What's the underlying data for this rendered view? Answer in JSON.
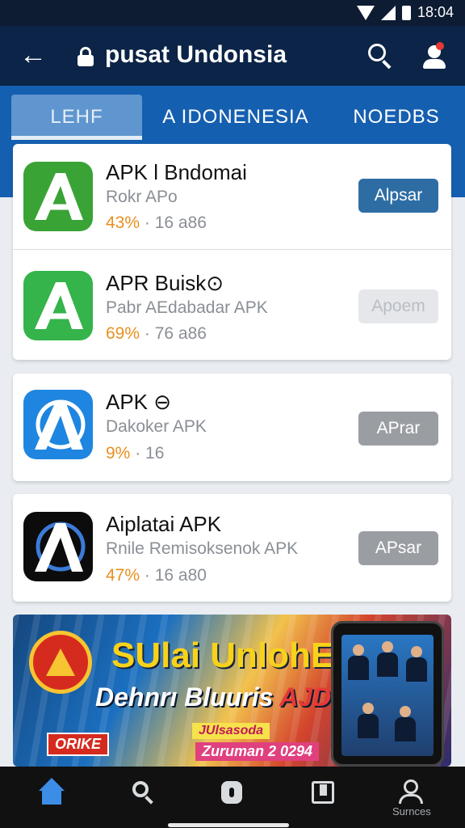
{
  "status_bar": {
    "time": "18:04"
  },
  "header": {
    "title": "pusat Undonsia"
  },
  "tabs": [
    {
      "label": "LEHF",
      "active": true
    },
    {
      "label": "A IDONENESIA",
      "active": false
    },
    {
      "label": "NOEDBS",
      "active": false
    }
  ],
  "apps": [
    {
      "name": "APK l Bndomai",
      "subtitle": "Rokr APo",
      "percent": "43%",
      "meta": "· 16 a86",
      "button": "Alpsar",
      "button_style": "blue",
      "icon": "green-a-logo-icon"
    },
    {
      "name": "APR Buisk⊙",
      "subtitle": "Pabr AEdabadar APK",
      "percent": "69%",
      "meta": "· 76 a86",
      "button": "Apoem",
      "button_style": "light",
      "icon": "green-a-logo-icon"
    },
    {
      "name": "APK ⊖",
      "subtitle": "Dakoker APK",
      "percent": "9%",
      "meta": "· 16",
      "button": "APrar",
      "button_style": "gray",
      "icon": "blue-a-logo-icon"
    },
    {
      "name": "Aiplatai APK",
      "subtitle": "Rnile Remisoksenok APK",
      "percent": "47%",
      "meta": "· 16 a80",
      "button": "APsar",
      "button_style": "gray",
      "icon": "black-a-logo-icon"
    }
  ],
  "banner": {
    "headline": "SUlai UnlohEa",
    "sub_main": "Dehnrı Bluuris ",
    "sub_accent": "AJDS",
    "badge": "ORIKE",
    "promo": "JUlsasoda",
    "date": "Zuruman 2 0294"
  },
  "bottom_nav": {
    "items": [
      "home-icon",
      "search-icon",
      "apps-icon",
      "library-icon",
      "account-icon"
    ],
    "active": "home",
    "account_label": "Surnces"
  },
  "colors": {
    "header": "#0b2447",
    "tab_bar": "#155fb0",
    "accent": "#2e6da4",
    "percent": "#e8901f"
  }
}
